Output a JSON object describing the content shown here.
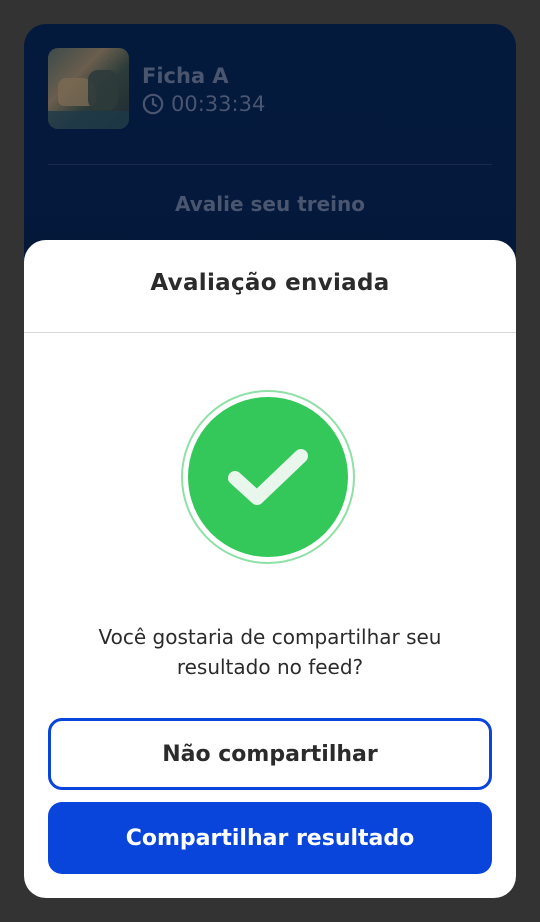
{
  "background_card": {
    "workout_title": "Ficha A",
    "workout_duration": "00:33:34",
    "rate_prompt": "Avalie seu treino"
  },
  "modal": {
    "title": "Avaliação enviada",
    "question": "Você gostaria de compartilhar seu resultado no feed?",
    "secondary_button_label": "Não compartilhar",
    "primary_button_label": "Compartilhar resultado"
  },
  "icons": {
    "clock": "clock-icon",
    "success": "checkmark-icon"
  },
  "colors": {
    "accent_blue": "#0a45db",
    "success_green": "#34c85a",
    "overlay": "#333333"
  }
}
